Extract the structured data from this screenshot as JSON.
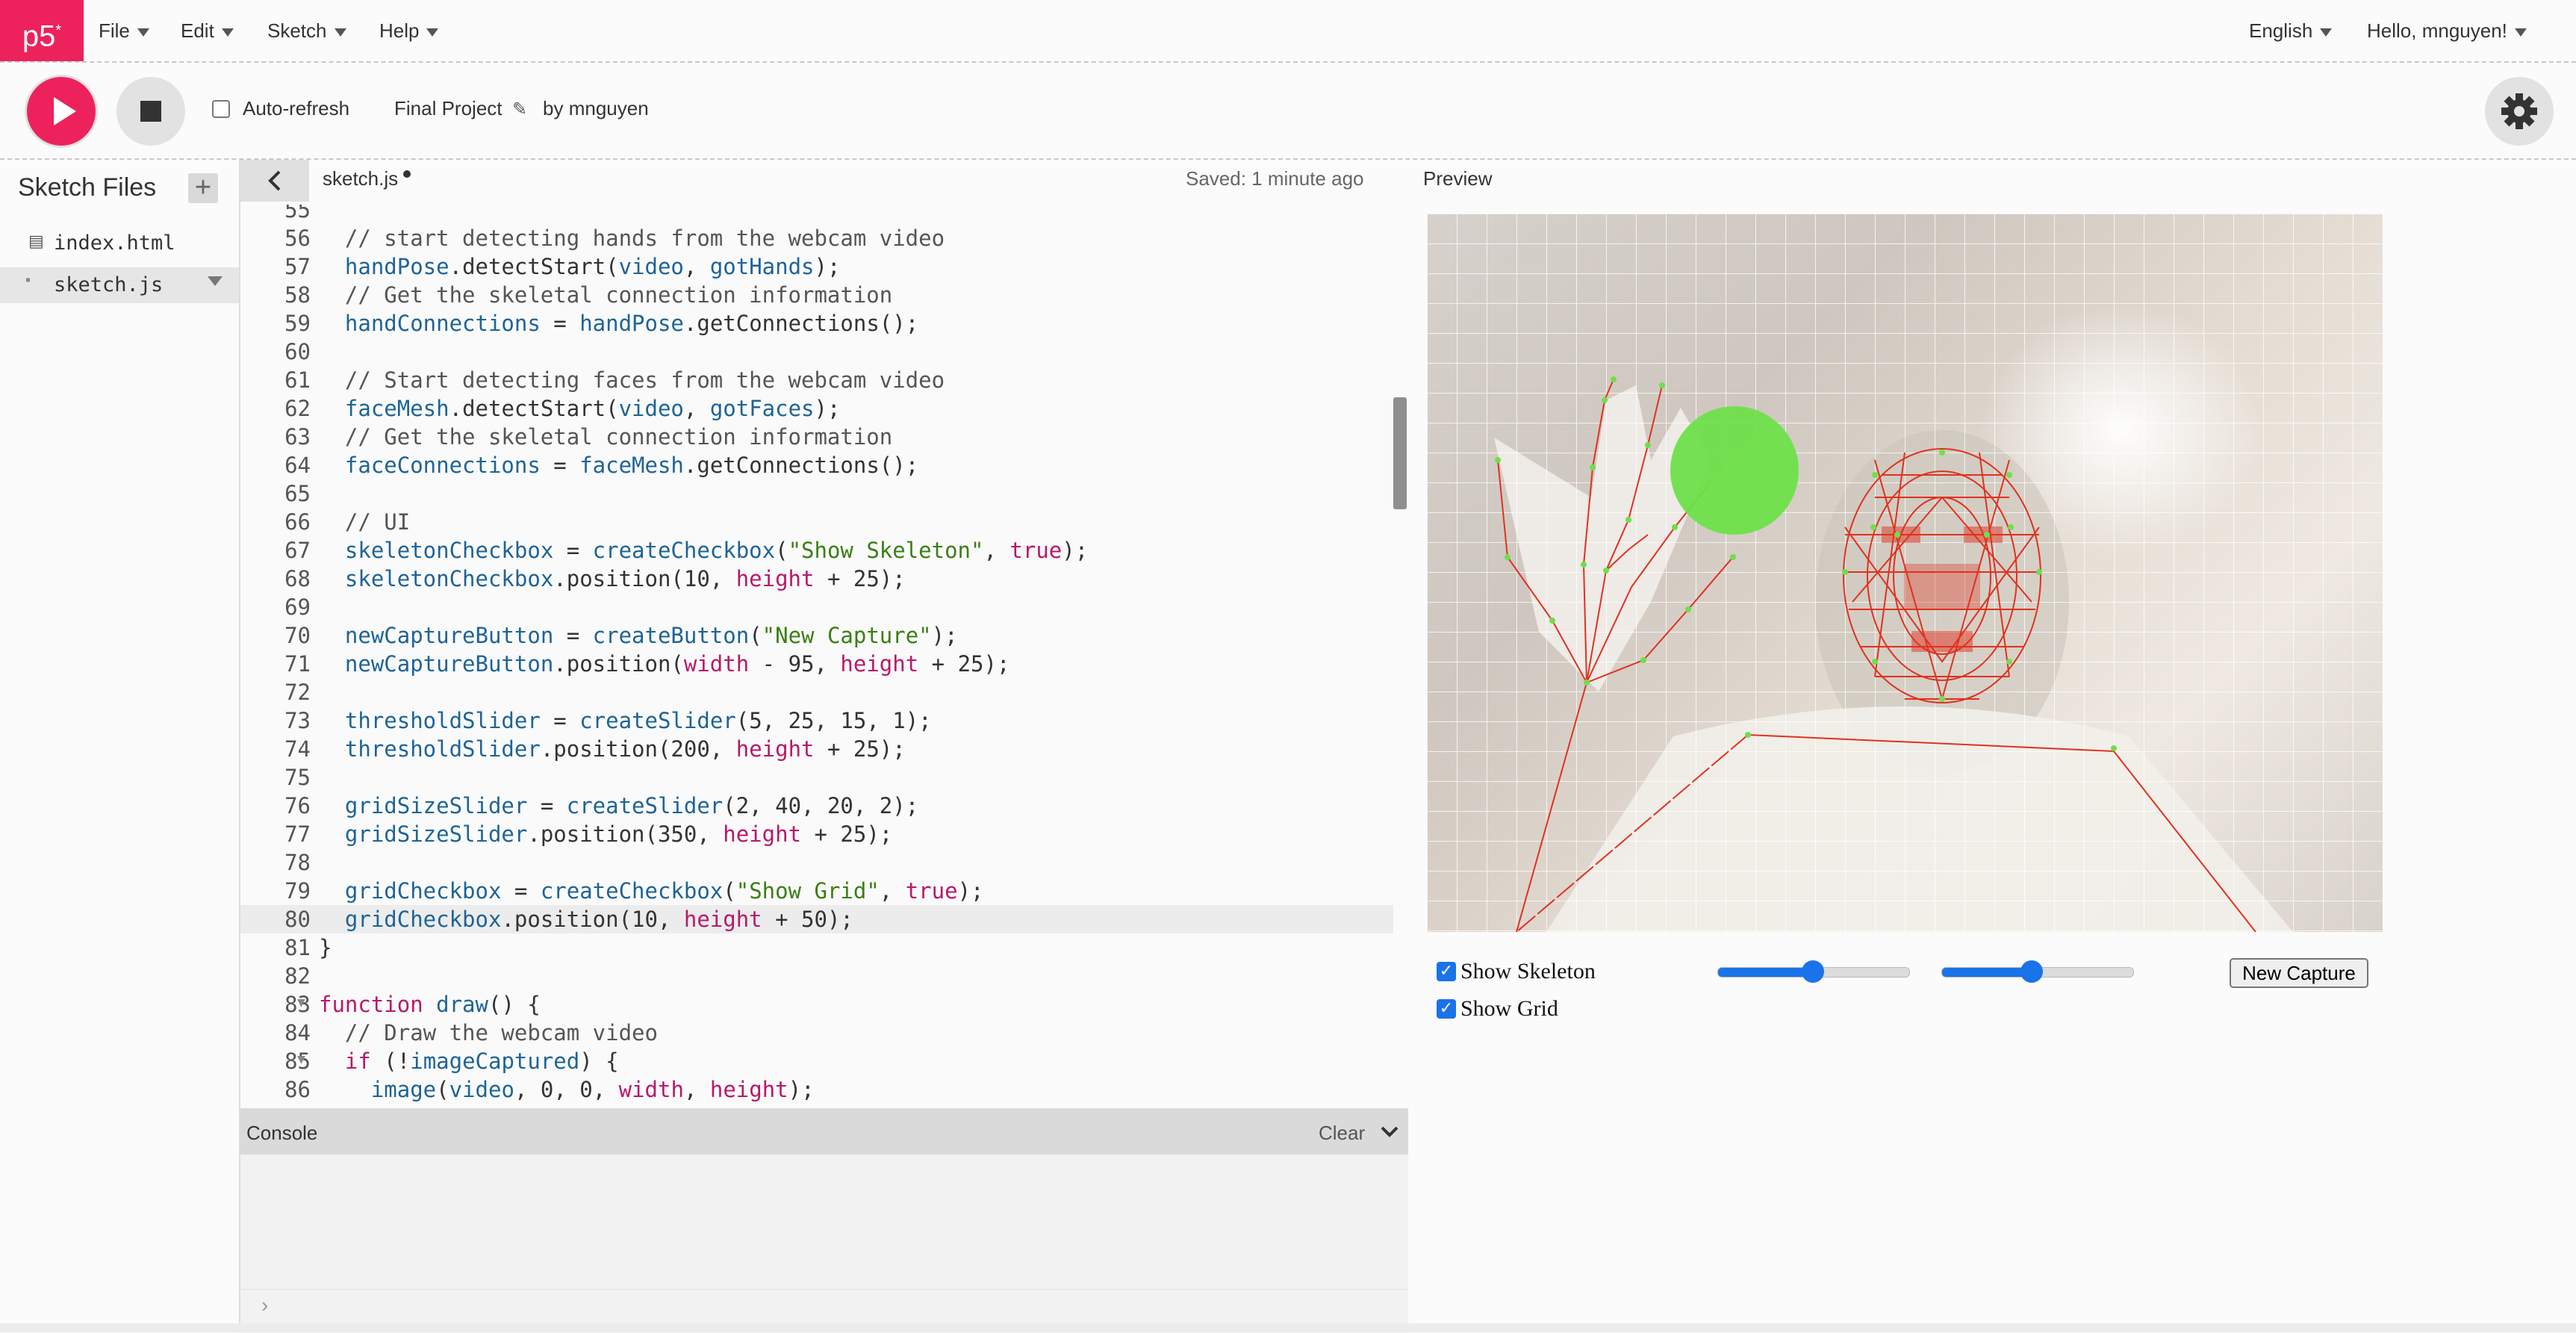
{
  "nav": {
    "logo": "p5",
    "logo_sup": "*",
    "menus": [
      "File",
      "Edit",
      "Sketch",
      "Help"
    ],
    "language": "English",
    "user": "Hello, mnguyen!"
  },
  "toolbar": {
    "auto_refresh_label": "Auto-refresh",
    "auto_refresh_checked": false,
    "project_name": "Final Project",
    "by_label": "by",
    "author": "mnguyen"
  },
  "sidebar": {
    "title": "Sketch Files",
    "add_symbol": "+",
    "files": [
      "index.html",
      "sketch.js"
    ]
  },
  "editor": {
    "tab_name": "sketch.js",
    "saved_status": "Saved: 1 minute ago",
    "current_line": 80,
    "lines": [
      {
        "n": "55",
        "t": []
      },
      {
        "n": "56",
        "t": [
          [
            "  // start detecting hands from the webcam video",
            "c-comment"
          ]
        ]
      },
      {
        "n": "57",
        "t": [
          [
            "  ",
            ""
          ],
          [
            "handPose",
            "c-var"
          ],
          [
            ".detectStart(",
            ""
          ],
          [
            "video",
            "c-var"
          ],
          [
            ", ",
            ""
          ],
          [
            "gotHands",
            "c-var"
          ],
          [
            ");",
            ""
          ]
        ]
      },
      {
        "n": "58",
        "t": [
          [
            "  // Get the skeletal connection information",
            "c-comment"
          ]
        ]
      },
      {
        "n": "59",
        "t": [
          [
            "  ",
            ""
          ],
          [
            "handConnections",
            "c-var"
          ],
          [
            " = ",
            ""
          ],
          [
            "handPose",
            "c-var"
          ],
          [
            ".getConnections();",
            ""
          ]
        ]
      },
      {
        "n": "60",
        "t": []
      },
      {
        "n": "61",
        "t": [
          [
            "  // Start detecting faces from the webcam video",
            "c-comment"
          ]
        ]
      },
      {
        "n": "62",
        "t": [
          [
            "  ",
            ""
          ],
          [
            "faceMesh",
            "c-var"
          ],
          [
            ".detectStart(",
            ""
          ],
          [
            "video",
            "c-var"
          ],
          [
            ", ",
            ""
          ],
          [
            "gotFaces",
            "c-var"
          ],
          [
            ");",
            ""
          ]
        ]
      },
      {
        "n": "63",
        "t": [
          [
            "  // Get the skeletal connection information",
            "c-comment"
          ]
        ]
      },
      {
        "n": "64",
        "t": [
          [
            "  ",
            ""
          ],
          [
            "faceConnections",
            "c-var"
          ],
          [
            " = ",
            ""
          ],
          [
            "faceMesh",
            "c-var"
          ],
          [
            ".getConnections();",
            ""
          ]
        ]
      },
      {
        "n": "65",
        "t": []
      },
      {
        "n": "66",
        "t": [
          [
            "  // UI",
            "c-comment"
          ]
        ]
      },
      {
        "n": "67",
        "t": [
          [
            "  ",
            ""
          ],
          [
            "skeletonCheckbox",
            "c-var"
          ],
          [
            " = ",
            ""
          ],
          [
            "createCheckbox",
            "c-var"
          ],
          [
            "(",
            ""
          ],
          [
            "\"Show Skeleton\"",
            "c-str"
          ],
          [
            ", ",
            ""
          ],
          [
            "true",
            "c-kw"
          ],
          [
            ");",
            ""
          ]
        ]
      },
      {
        "n": "68",
        "t": [
          [
            "  ",
            ""
          ],
          [
            "skeletonCheckbox",
            "c-var"
          ],
          [
            ".position(10, ",
            ""
          ],
          [
            "height",
            "c-kw"
          ],
          [
            " + 25);",
            ""
          ]
        ]
      },
      {
        "n": "69",
        "t": []
      },
      {
        "n": "70",
        "t": [
          [
            "  ",
            ""
          ],
          [
            "newCaptureButton",
            "c-var"
          ],
          [
            " = ",
            ""
          ],
          [
            "createButton",
            "c-var"
          ],
          [
            "(",
            ""
          ],
          [
            "\"New Capture\"",
            "c-str"
          ],
          [
            ");",
            ""
          ]
        ]
      },
      {
        "n": "71",
        "t": [
          [
            "  ",
            ""
          ],
          [
            "newCaptureButton",
            "c-var"
          ],
          [
            ".position(",
            ""
          ],
          [
            "width",
            "c-kw"
          ],
          [
            " - 95, ",
            ""
          ],
          [
            "height",
            "c-kw"
          ],
          [
            " + 25);",
            ""
          ]
        ]
      },
      {
        "n": "72",
        "t": []
      },
      {
        "n": "73",
        "t": [
          [
            "  ",
            ""
          ],
          [
            "thresholdSlider",
            "c-var"
          ],
          [
            " = ",
            ""
          ],
          [
            "createSlider",
            "c-var"
          ],
          [
            "(5, 25, 15, 1);",
            ""
          ]
        ]
      },
      {
        "n": "74",
        "t": [
          [
            "  ",
            ""
          ],
          [
            "thresholdSlider",
            "c-var"
          ],
          [
            ".position(200, ",
            ""
          ],
          [
            "height",
            "c-kw"
          ],
          [
            " + 25);",
            ""
          ]
        ]
      },
      {
        "n": "75",
        "t": []
      },
      {
        "n": "76",
        "t": [
          [
            "  ",
            ""
          ],
          [
            "gridSizeSlider",
            "c-var"
          ],
          [
            " = ",
            ""
          ],
          [
            "createSlider",
            "c-var"
          ],
          [
            "(2, 40, 20, 2);",
            ""
          ]
        ]
      },
      {
        "n": "77",
        "t": [
          [
            "  ",
            ""
          ],
          [
            "gridSizeSlider",
            "c-var"
          ],
          [
            ".position(350, ",
            ""
          ],
          [
            "height",
            "c-kw"
          ],
          [
            " + 25);",
            ""
          ]
        ]
      },
      {
        "n": "78",
        "t": []
      },
      {
        "n": "79",
        "t": [
          [
            "  ",
            ""
          ],
          [
            "gridCheckbox",
            "c-var"
          ],
          [
            " = ",
            ""
          ],
          [
            "createCheckbox",
            "c-var"
          ],
          [
            "(",
            ""
          ],
          [
            "\"Show Grid\"",
            "c-str"
          ],
          [
            ", ",
            ""
          ],
          [
            "true",
            "c-kw"
          ],
          [
            ");",
            ""
          ]
        ]
      },
      {
        "n": "80",
        "t": [
          [
            "  ",
            ""
          ],
          [
            "gridCheckbox",
            "c-var"
          ],
          [
            ".position(10, ",
            ""
          ],
          [
            "height",
            "c-kw"
          ],
          [
            " + 50);",
            ""
          ]
        ]
      },
      {
        "n": "81",
        "t": [
          [
            "}",
            ""
          ]
        ]
      },
      {
        "n": "82",
        "t": []
      },
      {
        "n": "83",
        "t": [
          [
            "function ",
            "c-kw"
          ],
          [
            "draw",
            "c-var"
          ],
          [
            "() {",
            ""
          ]
        ],
        "fold": true
      },
      {
        "n": "84",
        "t": [
          [
            "  // Draw the webcam video",
            "c-comment"
          ]
        ]
      },
      {
        "n": "85",
        "t": [
          [
            "  ",
            ""
          ],
          [
            "if",
            "c-kw"
          ],
          [
            " (!",
            ""
          ],
          [
            "imageCaptured",
            "c-var"
          ],
          [
            ") {",
            ""
          ]
        ],
        "fold": true
      },
      {
        "n": "86",
        "t": [
          [
            "    ",
            ""
          ],
          [
            "image",
            "c-var"
          ],
          [
            "(",
            ""
          ],
          [
            "video",
            "c-var"
          ],
          [
            ", 0, 0, ",
            ""
          ],
          [
            "width",
            "c-kw"
          ],
          [
            ", ",
            ""
          ],
          [
            "height",
            "c-kw"
          ],
          [
            ");",
            ""
          ]
        ]
      }
    ]
  },
  "console": {
    "label": "Console",
    "clear_label": "Clear"
  },
  "preview": {
    "label": "Preview",
    "show_skeleton_label": "Show Skeleton",
    "show_skeleton_checked": true,
    "show_grid_label": "Show Grid",
    "show_grid_checked": true,
    "threshold_slider": {
      "min": 5,
      "max": 25,
      "value": 15
    },
    "grid_size_slider": {
      "min": 2,
      "max": 40,
      "value": 20
    },
    "new_capture_label": "New Capture"
  },
  "colors": {
    "brand": "#ed225d",
    "accent": "#1a73e8",
    "skeleton": "#e0311f",
    "keypoint": "#6ee04a"
  }
}
